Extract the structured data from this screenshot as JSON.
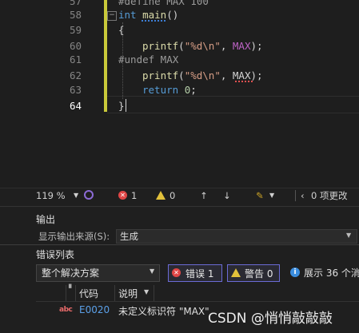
{
  "editor": {
    "lines": [
      {
        "num": "57",
        "text": "#define MAX 100"
      },
      {
        "num": "58",
        "tokens": [
          "int",
          " ",
          "main",
          "()"
        ]
      },
      {
        "num": "59",
        "text": "{"
      },
      {
        "num": "60",
        "text": "printf(\"%d\\n\", MAX);"
      },
      {
        "num": "61",
        "text": "#undef MAX"
      },
      {
        "num": "62",
        "text": "printf(\"%d\\n\", MAX);"
      },
      {
        "num": "63",
        "text": "return 0;"
      },
      {
        "num": "64",
        "text": "}"
      }
    ],
    "colors": {
      "keyword": "#569cd6",
      "function": "#dcdcaa",
      "string": "#d69d85",
      "macro": "#bd63c5",
      "change_bar": "#c9c93a"
    }
  },
  "statusbar": {
    "zoom": "119 %",
    "errors": "1",
    "warnings": "0",
    "changes": "0 项更改"
  },
  "output": {
    "title": "输出",
    "source_label": "显示输出来源(S):",
    "source_value": "生成"
  },
  "error_list": {
    "title": "错误列表",
    "scope": "整个解决方案",
    "errors_label": "错误 1",
    "warnings_label": "警告 0",
    "messages_label": "展示 36 个消",
    "columns": {
      "code": "代码",
      "description": "说明"
    },
    "rows": [
      {
        "icon": "abc",
        "code": "E0020",
        "description": "未定义标识符 \"MAX\""
      }
    ]
  },
  "watermark": "CSDN @悄悄敲敲敲"
}
